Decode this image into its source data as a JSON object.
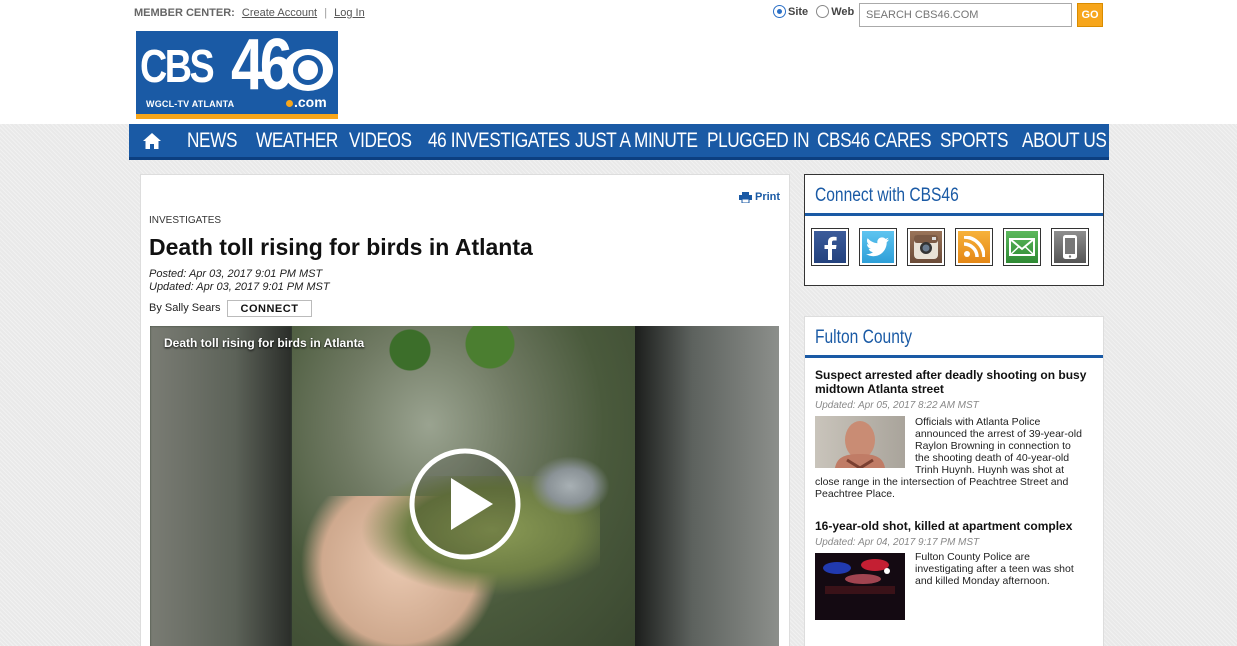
{
  "header": {
    "member_center_label": "MEMBER CENTER:",
    "create_account": "Create Account",
    "separator": "|",
    "login": "Log In",
    "search_scope": {
      "options": [
        "Site",
        "Web"
      ],
      "selected": "Site"
    },
    "search_placeholder": "SEARCH CBS46.COM",
    "go_label": "GO"
  },
  "logo": {
    "brand": "CBS",
    "number": "46",
    "station": "WGCL-TV ATLANTA",
    "domain": ".com"
  },
  "nav": {
    "home_icon": "home-icon",
    "items": [
      "NEWS",
      "WEATHER",
      "VIDEOS",
      "46 INVESTIGATES",
      "JUST A MINUTE",
      "PLUGGED IN",
      "CBS46 CARES",
      "SPORTS",
      "ABOUT US"
    ]
  },
  "article": {
    "print_label": "Print",
    "section": "INVESTIGATES",
    "headline": "Death toll rising for birds in Atlanta",
    "posted": "Posted: Apr 03, 2017 9:01 PM MST",
    "updated": "Updated: Apr 03, 2017 9:01 PM MST",
    "byline": "By Sally Sears",
    "connect_label": "CONNECT",
    "video_title": "Death toll rising for birds in Atlanta"
  },
  "connect_box": {
    "title": "Connect with CBS46",
    "icons": [
      "facebook-icon",
      "twitter-icon",
      "instagram-icon",
      "rss-icon",
      "email-icon",
      "mobile-icon"
    ]
  },
  "county_box": {
    "title": "Fulton County",
    "stories": [
      {
        "title": "Suspect arrested after deadly shooting on busy midtown Atlanta street",
        "date": "Updated: Apr 05, 2017 8:22 AM MST",
        "summary_lines": [
          "Officials with Atlanta Police",
          "announced the arrest of 39-year-old",
          "Raylon Browning in connection to",
          "the shooting death of 40-year-old",
          "Trinh Huynh. Huynh was shot at"
        ],
        "summary_tail": [
          "close range in the intersection of Peachtree Street and",
          "Peachtree Place."
        ]
      },
      {
        "title": "16-year-old shot, killed at apartment complex",
        "date": "Updated: Apr 04, 2017 9:17 PM MST",
        "summary_lines": [
          "Fulton County Police are",
          "investigating after a teen was shot",
          "and killed Monday afternoon."
        ]
      }
    ]
  },
  "colors": {
    "brand_blue": "#1a5aa5",
    "accent_orange": "#f7a61b"
  }
}
